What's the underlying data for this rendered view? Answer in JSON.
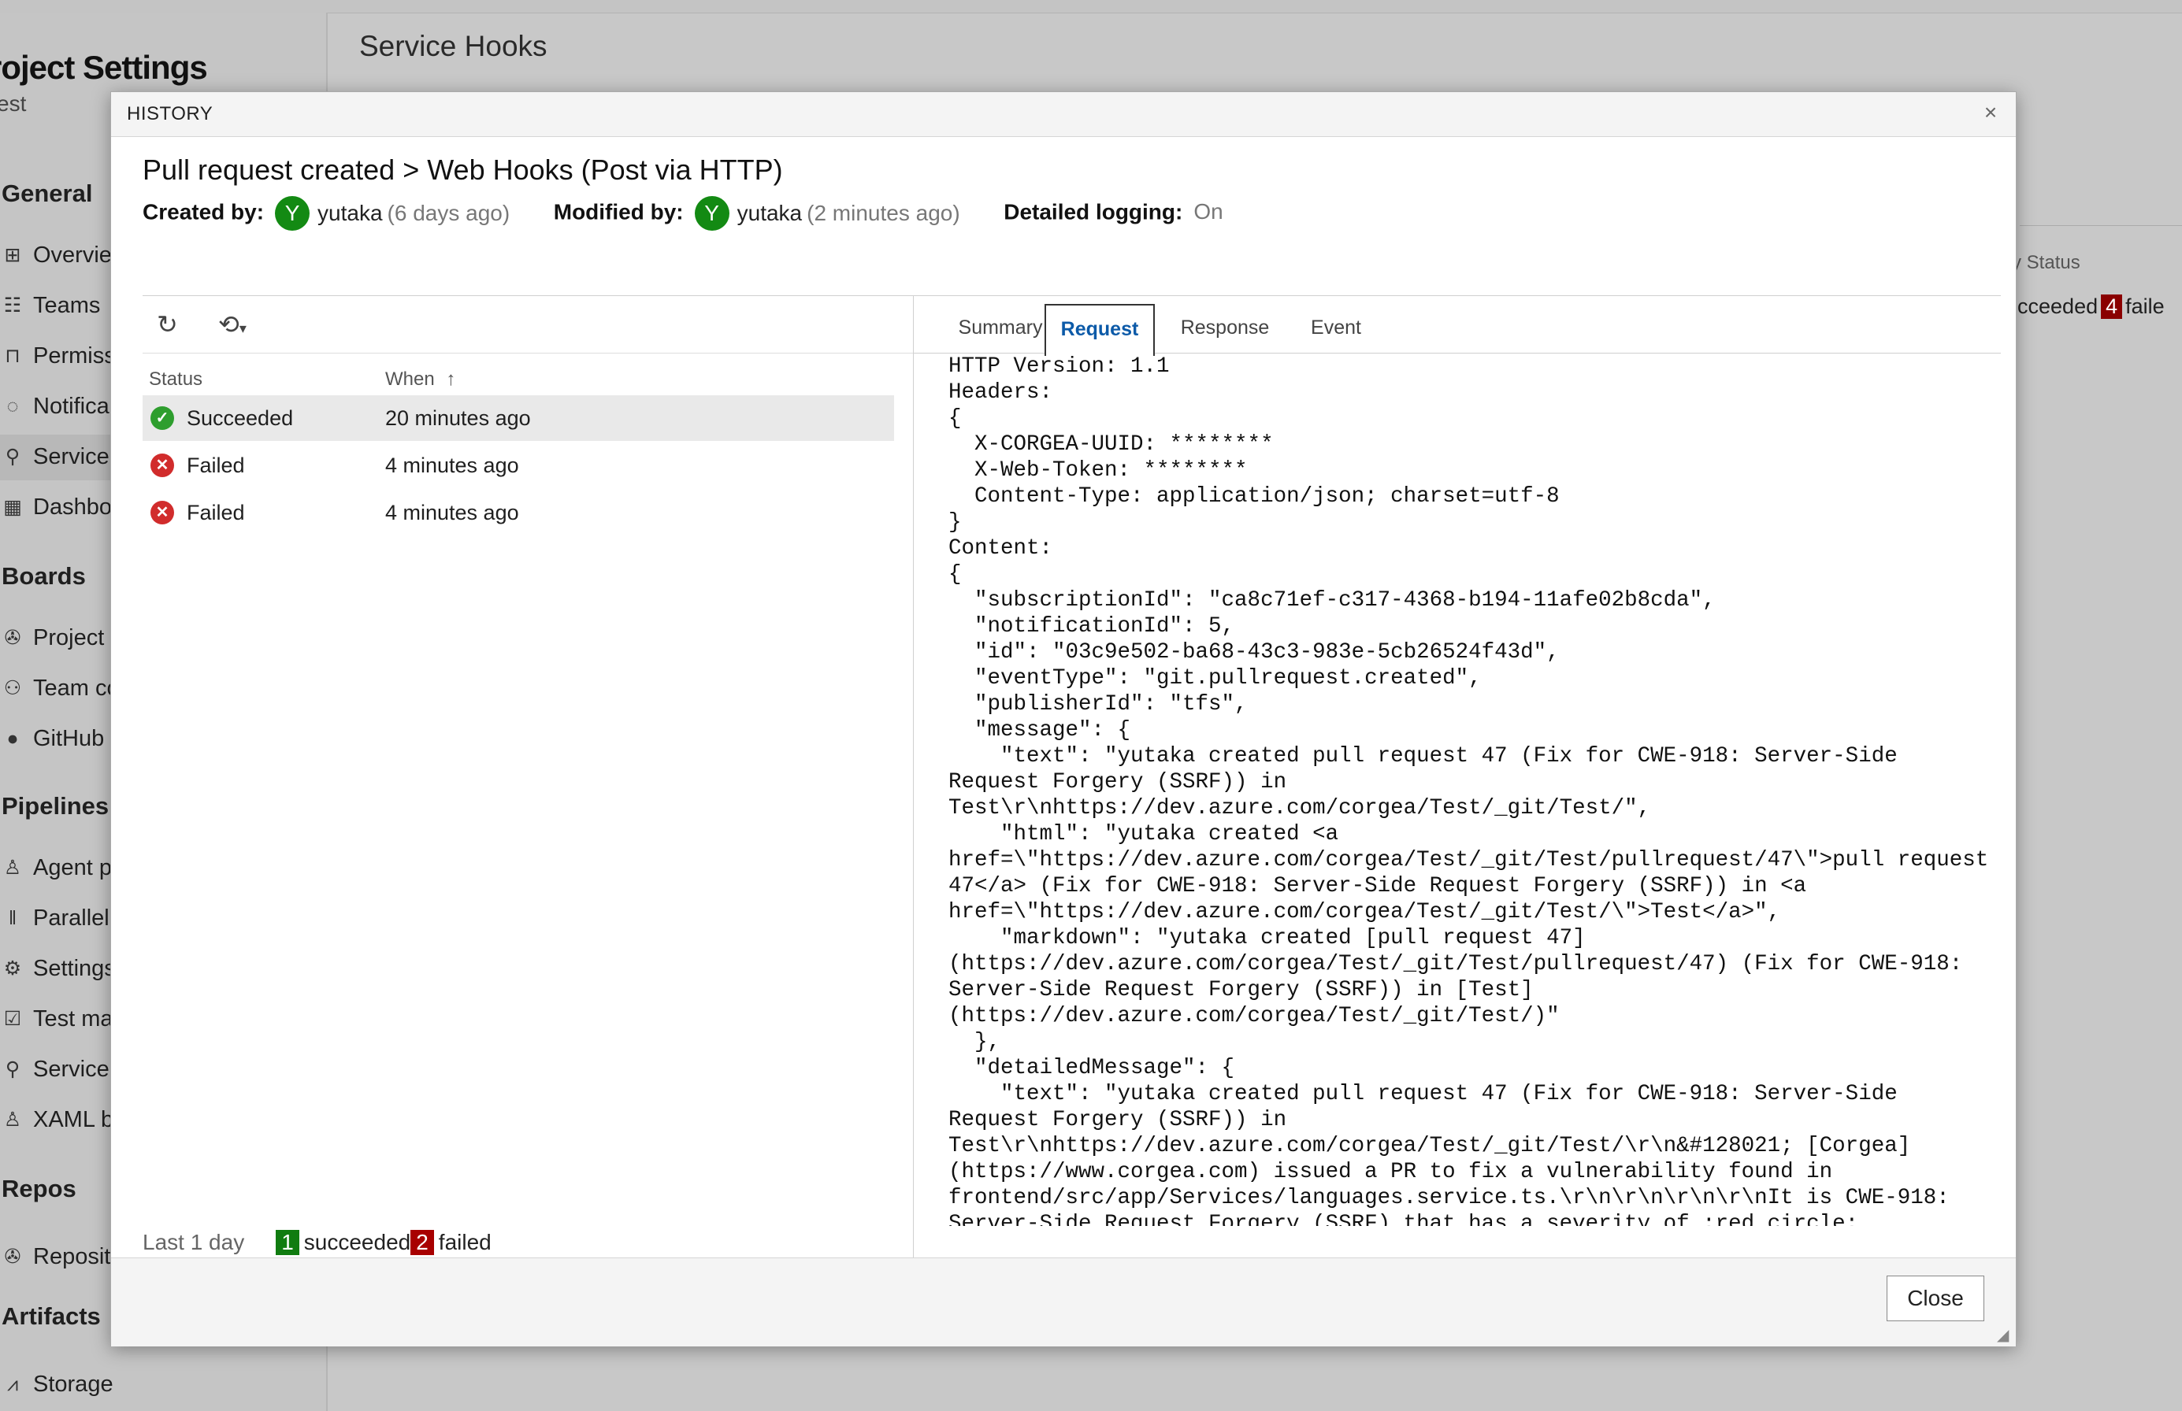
{
  "background": {
    "sidebar_title": "roject Settings",
    "sidebar_subtitle": "est",
    "page_title": "Service Hooks",
    "groups": [
      "General",
      "Boards",
      "Pipelines",
      "Repos",
      "Artifacts"
    ],
    "items": {
      "overview": {
        "label": "Overvie",
        "icon": "grid-icon"
      },
      "teams": {
        "label": "Teams",
        "icon": "team-icon"
      },
      "permissions": {
        "label": "Permiss",
        "icon": "lock-icon"
      },
      "notifications": {
        "label": "Notifica",
        "icon": "chat-icon"
      },
      "service_hooks": {
        "label": "Service",
        "icon": "hook-icon"
      },
      "dashboards": {
        "label": "Dashbo",
        "icon": "dashboard-icon"
      },
      "project_config": {
        "label": "Project",
        "icon": "gear-cog-icon"
      },
      "team_config": {
        "label": "Team co",
        "icon": "people-icon"
      },
      "github": {
        "label": "GitHub",
        "icon": "github-icon"
      },
      "agent_pools": {
        "label": "Agent p",
        "icon": "agent-icon"
      },
      "parallel": {
        "label": "Parallel",
        "icon": "parallel-icon"
      },
      "settings": {
        "label": "Settings",
        "icon": "settings-icon"
      },
      "test_management": {
        "label": "Test ma",
        "icon": "test-icon"
      },
      "service_connections": {
        "label": "Service",
        "icon": "connection-icon"
      },
      "xaml": {
        "label": "XAML b",
        "icon": "xaml-icon"
      },
      "repositories": {
        "label": "Reposit",
        "icon": "repo-icon"
      },
      "storage": {
        "label": "Storage",
        "icon": "chart-icon"
      }
    },
    "status_column": "y Status",
    "status_row": {
      "prefix": "ucceeded",
      "count": "4",
      "suffix": "faile"
    }
  },
  "dialog": {
    "title": "HISTORY",
    "heading": "Pull request created > Web Hooks (Post via HTTP)",
    "created_label": "Created by:",
    "created_user": "yutaka",
    "created_time": "(6 days ago)",
    "modified_label": "Modified by:",
    "modified_user": "yutaka",
    "modified_time": "(2 minutes ago)",
    "avatar_initial": "Y",
    "logging_label": "Detailed logging:",
    "logging_value": "On",
    "columns": {
      "status": "Status",
      "when": "When"
    },
    "rows": [
      {
        "status": "Succeeded",
        "when": "20 minutes ago",
        "state": "ok"
      },
      {
        "status": "Failed",
        "when": "4 minutes ago",
        "state": "fail"
      },
      {
        "status": "Failed",
        "when": "4 minutes ago",
        "state": "fail"
      }
    ],
    "footer": {
      "range": "Last 1 day",
      "succeeded_count": "1",
      "succeeded_label": "succeeded",
      "failed_count": "2",
      "failed_label": "failed"
    },
    "tabs": {
      "summary": "Summary",
      "request": "Request",
      "response": "Response",
      "event": "Event"
    },
    "request_body": "HTTP Version: 1.1\nHeaders:\n{\n  X-CORGEA-UUID: ********\n  X-Web-Token: ********\n  Content-Type: application/json; charset=utf-8\n}\nContent:\n{\n  \"subscriptionId\": \"ca8c71ef-c317-4368-b194-11afe02b8cda\",\n  \"notificationId\": 5,\n  \"id\": \"03c9e502-ba68-43c3-983e-5cb26524f43d\",\n  \"eventType\": \"git.pullrequest.created\",\n  \"publisherId\": \"tfs\",\n  \"message\": {\n    \"text\": \"yutaka created pull request 47 (Fix for CWE-918: Server-Side\nRequest Forgery (SSRF)) in\nTest\\r\\nhttps://dev.azure.com/corgea/Test/_git/Test/\",\n    \"html\": \"yutaka created <a\nhref=\\\"https://dev.azure.com/corgea/Test/_git/Test/pullrequest/47\\\">pull request\n47</a> (Fix for CWE-918: Server-Side Request Forgery (SSRF)) in <a\nhref=\\\"https://dev.azure.com/corgea/Test/_git/Test/\\\">Test</a>\",\n    \"markdown\": \"yutaka created [pull request 47]\n(https://dev.azure.com/corgea/Test/_git/Test/pullrequest/47) (Fix for CWE-918:\nServer-Side Request Forgery (SSRF)) in [Test]\n(https://dev.azure.com/corgea/Test/_git/Test/)\"\n  },\n  \"detailedMessage\": {\n    \"text\": \"yutaka created pull request 47 (Fix for CWE-918: Server-Side\nRequest Forgery (SSRF)) in\nTest\\r\\nhttps://dev.azure.com/corgea/Test/_git/Test/\\r\\n&#128021; [Corgea]\n(https://www.corgea.com) issued a PR to fix a vulnerability found in\nfrontend/src/app/Services/languages.service.ts.\\r\\n\\r\\n\\r\\n\\r\\nIt is CWE-918:\nServer-Side Request Forgery (SSRF) that has a severity of :red_circle:",
    "close_label": "Close"
  }
}
